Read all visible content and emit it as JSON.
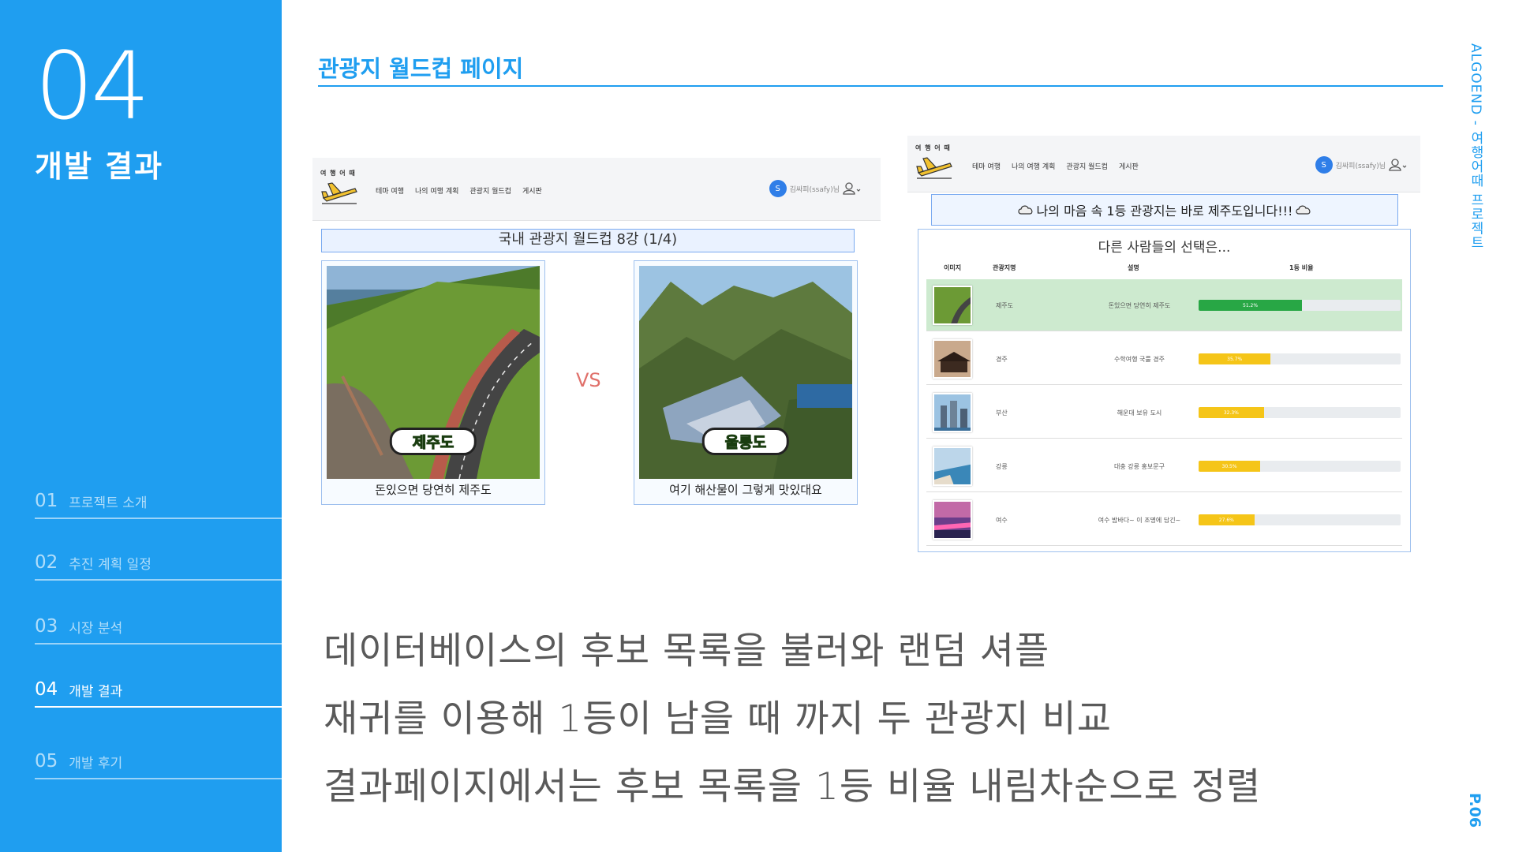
{
  "sidebar": {
    "section_number": "04",
    "section_title": "개발 결과",
    "items": [
      {
        "num": "01",
        "label": "프로젝트 소개"
      },
      {
        "num": "02",
        "label": "추진 계획 일정"
      },
      {
        "num": "03",
        "label": "시장 분석"
      },
      {
        "num": "04",
        "label": "개발 결과"
      },
      {
        "num": "05",
        "label": "개발 후기"
      }
    ]
  },
  "header": {
    "title": "관광지 월드컵 페이지",
    "vertical_title": "ALGOEND - 여행어때 프로젝트",
    "page": "P.06"
  },
  "app": {
    "logo_text": "여 행 어 때",
    "menu": [
      "테마 여행",
      "나의 여행 계획",
      "관광지 월드컵",
      "게시판"
    ],
    "user_initial": "S",
    "user_name": "김싸피(ssafy)님"
  },
  "worldcup": {
    "round_label": "국내 관광지 월드컵 8강 (1/4)",
    "vs_label": "VS",
    "left": {
      "name": "제주도",
      "caption": "돈있으면 당연히 제주도"
    },
    "right": {
      "name": "울릉도",
      "caption": "여기 해산물이 그렇게 맛있대요"
    }
  },
  "result": {
    "banner": "나의 마음 속 1등 관광지는 바로 제주도입니다!!!",
    "title": "다른 사람들의 선택은...",
    "columns": [
      "이미지",
      "관광지명",
      "설명",
      "1등 비율"
    ],
    "rows": [
      {
        "name": "제주도",
        "desc": "돈있으면 당연히 제주도",
        "pct": 51.2,
        "label": "51.2%",
        "color": "#28a745"
      },
      {
        "name": "경주",
        "desc": "수학여행 국룰 경주",
        "pct": 35.7,
        "label": "35.7%",
        "color": "#f5c518"
      },
      {
        "name": "부산",
        "desc": "해운대 보유 도시",
        "pct": 32.3,
        "label": "32.3%",
        "color": "#f5c518"
      },
      {
        "name": "강릉",
        "desc": "대충 강릉 홍보문구",
        "pct": 30.5,
        "label": "30.5%",
        "color": "#f5c518"
      },
      {
        "name": "여수",
        "desc": "여수 밤바다~ 이 조명에 담긴~",
        "pct": 27.6,
        "label": "27.6%",
        "color": "#f5c518"
      }
    ]
  },
  "description": [
    "데이터베이스의 후보 목록을 불러와 랜덤 셔플",
    "재귀를 이용해 1등이 남을 때 까지 두 관광지 비교",
    "결과페이지에서는 후보 목록을 1등 비율 내림차순으로 정렬"
  ],
  "colors": {
    "accent": "#1f9ef0",
    "vs": "#e0706a",
    "top_row": "#cdeacf"
  }
}
